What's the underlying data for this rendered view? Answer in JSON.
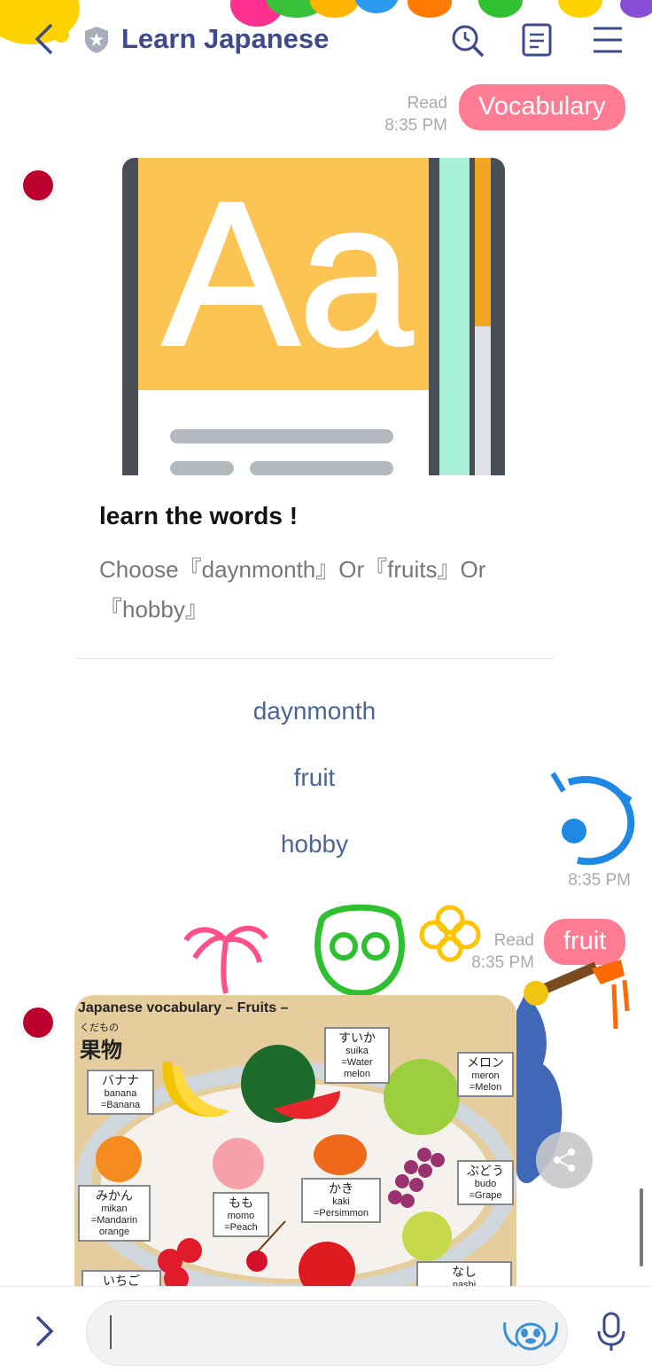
{
  "header": {
    "title": "Learn Japanese",
    "back_icon": "chevron-left-icon",
    "shield_icon": "shield-star-icon",
    "search_icon": "search-icon",
    "notes_icon": "notes-icon",
    "menu_icon": "menu-icon"
  },
  "colors": {
    "title": "#3d4a8c",
    "pink_bubble": "#ff7c93",
    "link": "#4a6497",
    "avatar_red": "#bc002d"
  },
  "messages": {
    "vocab": {
      "read": "Read",
      "time": "8:35 PM",
      "text": "Vocabulary"
    },
    "card": {
      "title": "learn the words !",
      "description": "Choose『daynmonth』Or『fruits』Or『hobby』",
      "actions": [
        "daynmonth",
        "fruit",
        "hobby"
      ],
      "time": "8:35 PM"
    },
    "fruit": {
      "read": "Read",
      "time": "8:35 PM",
      "text": "fruit"
    }
  },
  "fruit_image": {
    "heading": "Japanese vocabulary",
    "heading_accent": "– Fruits –",
    "kana": "くだもの",
    "kanji": "果物",
    "labels": [
      {
        "jp": "バナナ",
        "romaji": "banana",
        "en": "=Banana"
      },
      {
        "jp": "すいか",
        "romaji": "suika",
        "en": "=Water melon"
      },
      {
        "jp": "メロン",
        "romaji": "meron",
        "en": "=Melon"
      },
      {
        "jp": "みかん",
        "romaji": "mikan",
        "en": "=Mandarin orange"
      },
      {
        "jp": "もも",
        "romaji": "momo",
        "en": "=Peach"
      },
      {
        "jp": "かき",
        "romaji": "kaki",
        "en": "=Persimmon"
      },
      {
        "jp": "ぶどう",
        "romaji": "budo",
        "en": "=Grape"
      },
      {
        "jp": "いちご",
        "romaji": "",
        "en": ""
      },
      {
        "jp": "なし",
        "romaji": "nashi",
        "en": ""
      }
    ]
  },
  "bottom_bar": {
    "expand_icon": "chevron-right-icon",
    "input_value": "",
    "sticker_icon": "sticker-icon",
    "mic_icon": "microphone-icon",
    "share_icon": "share-icon"
  }
}
